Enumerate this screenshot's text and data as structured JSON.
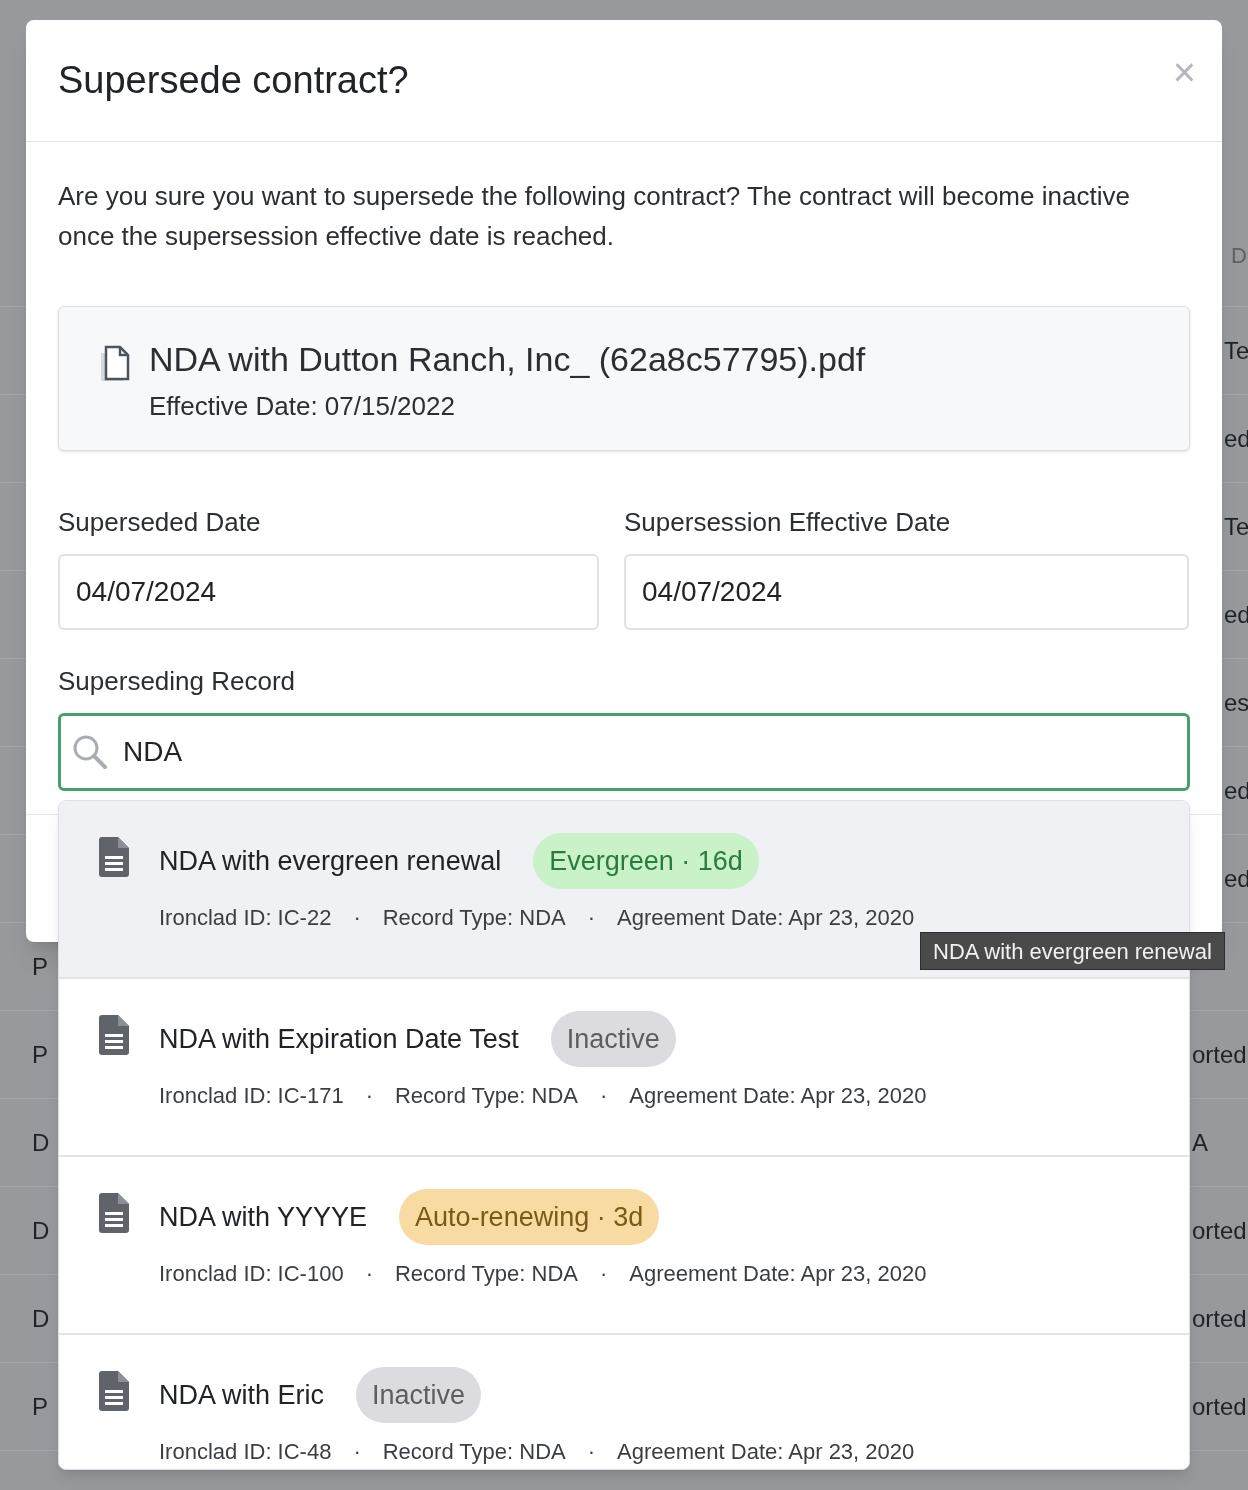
{
  "background": {
    "header_fragment": "D",
    "rows": [
      {
        "left": "",
        "right": "Te"
      },
      {
        "left": "",
        "right": "ed"
      },
      {
        "left": "",
        "right": "Te"
      },
      {
        "left": "",
        "right": "ed"
      },
      {
        "left": "",
        "right": "es"
      },
      {
        "left": "",
        "right": "ed"
      },
      {
        "left": "",
        "right": "ed"
      },
      {
        "left": "P",
        "right": ""
      },
      {
        "left": "P",
        "right": "orted"
      },
      {
        "left": "D",
        "right": "A"
      },
      {
        "left": "D",
        "right": "orted"
      },
      {
        "left": "D",
        "right": "orted"
      },
      {
        "left": "P",
        "right": "orted"
      }
    ]
  },
  "dialog": {
    "title": "Supersede contract?",
    "close": "×",
    "message": "Are you sure you want to supersede the following contract? The contract will become inactive once the supersession effective date is reached.",
    "contract": {
      "name": "NDA with Dutton Ranch, Inc_ (62a8c57795).pdf",
      "effective_date": "Effective Date: 07/15/2022"
    },
    "fields": [
      {
        "label": "Superseded Date",
        "value": "04/07/2024"
      },
      {
        "label": "Supersession Effective Date",
        "value": "04/07/2024"
      }
    ],
    "search": {
      "label": "Superseding Record",
      "value": "NDA",
      "focused": true
    }
  },
  "results": [
    {
      "title": "NDA with evergreen renewal",
      "highlighted": true,
      "badge": {
        "text": "Evergreen · 16d",
        "kind": "success"
      },
      "meta": [
        "Ironclad ID: IC-22",
        "Record Type: NDA",
        "Agreement Date: Apr 23, 2020"
      ]
    },
    {
      "title": "NDA with Expiration Date Test",
      "highlighted": false,
      "badge": {
        "text": "Inactive",
        "kind": "neutral"
      },
      "meta": [
        "Ironclad ID: IC-171",
        "Record Type: NDA",
        "Agreement Date: Apr 23, 2020"
      ]
    },
    {
      "title": "NDA with YYYYE",
      "highlighted": false,
      "badge": {
        "text": "Auto-renewing · 3d",
        "kind": "warning"
      },
      "meta": [
        "Ironclad ID: IC-100",
        "Record Type: NDA",
        "Agreement Date: Apr 23, 2020"
      ]
    },
    {
      "title": "NDA with Eric",
      "highlighted": false,
      "badge": {
        "text": "Inactive",
        "kind": "neutral"
      },
      "meta": [
        "Ironclad ID: IC-48",
        "Record Type: NDA",
        "Agreement Date: Apr 23, 2020"
      ]
    }
  ],
  "separator": "·",
  "tooltip": "NDA with evergreen renewal"
}
